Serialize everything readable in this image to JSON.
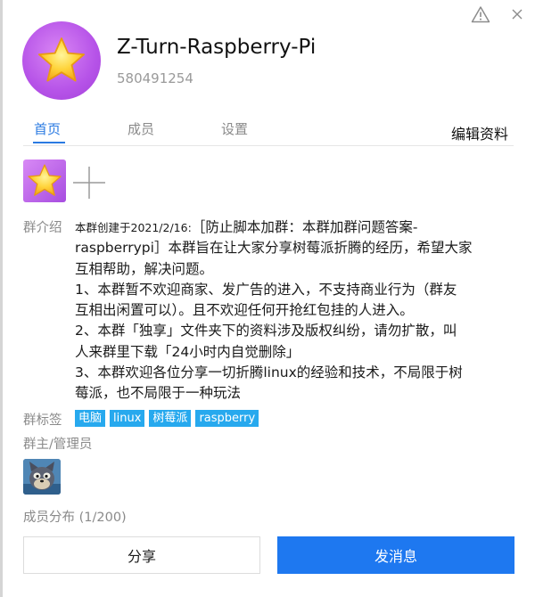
{
  "window": {
    "report_icon": "warning-triangle-icon",
    "close_icon": "close-icon"
  },
  "group": {
    "name": "Z-Turn-Raspberry-Pi",
    "id": "580491254"
  },
  "tabs": [
    "首页",
    "成员",
    "设置"
  ],
  "active_tab": "首页",
  "edit_profile": "编辑资料",
  "intro": {
    "label": "群介绍",
    "prefix": "本群创建于2021/2/16:",
    "line1_rest": "［防止脚本加群：本群加群问题答案-",
    "lines": [
      "raspberrypi］本群旨在让大家分享树莓派折腾的经历，希望大家",
      "互相帮助，解决问题。",
      "1、本群暂不欢迎商家、发广告的进入，不支持商业行为（群友",
      "互相出闲置可以）。且不欢迎任何开抢红包挂的人进入。",
      "2、本群「独享」文件夹下的资料涉及版权纠纷，请勿扩散，叫",
      "人来群里下载「24小时内自觉删除」",
      " 3、本群欢迎各位分享一切折腾linux的经验和技术，不局限于树",
      "莓派，也不局限于一种玩法"
    ]
  },
  "tags": {
    "label": "群标签",
    "items": [
      "电脑",
      "linux",
      "树莓派",
      "raspberry"
    ]
  },
  "admins": {
    "label": "群主/管理员"
  },
  "members": {
    "label": "成员分布 (1/200)"
  },
  "buttons": {
    "share": "分享",
    "send": "发消息"
  },
  "colors": {
    "accent": "#2a7ae2",
    "tag": "#27a9ee",
    "primary_button": "#1e78f0"
  }
}
